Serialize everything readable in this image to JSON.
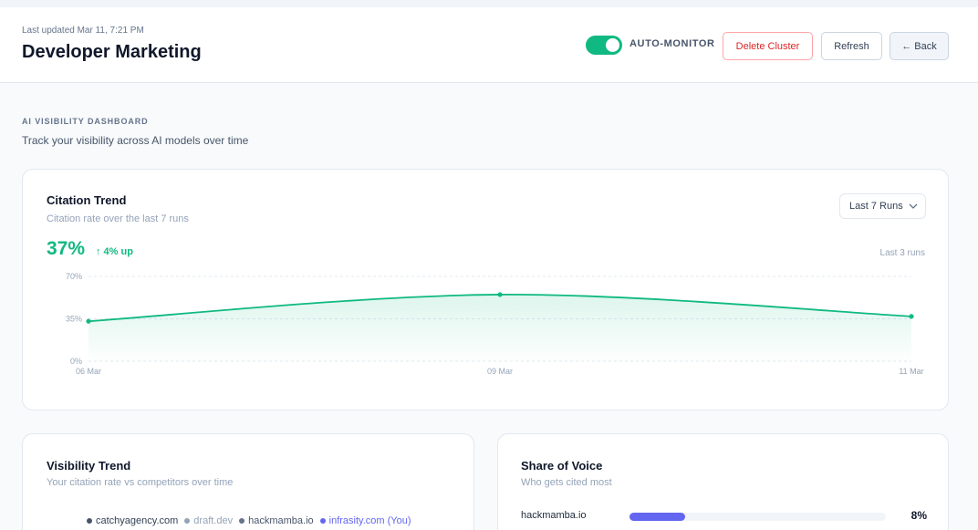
{
  "header": {
    "last_updated": "Last updated Mar 11, 7:21 PM",
    "title": "Developer Marketing",
    "auto_monitor_label": "AUTO-MONITOR",
    "auto_monitor_on": true,
    "delete_label": "Delete Cluster",
    "refresh_label": "Refresh",
    "back_label": "← Back"
  },
  "section": {
    "label": "AI VISIBILITY DASHBOARD",
    "subtitle": "Track your visibility across AI models over time"
  },
  "citation": {
    "title": "Citation Trend",
    "subtitle": "Citation rate over the last 7 runs",
    "select_value": "Last 7 Runs",
    "value": "37%",
    "delta": "↑ 4% up",
    "runs_note": "Last 3 runs"
  },
  "chart_data": {
    "type": "area",
    "x": [
      "06 Mar",
      "09 Mar",
      "11 Mar"
    ],
    "values": [
      33,
      55,
      37
    ],
    "ylim": [
      0,
      70
    ],
    "yticks": [
      "0%",
      "35%",
      "70%"
    ],
    "grid": true,
    "color": "#10b981"
  },
  "visibility": {
    "title": "Visibility Trend",
    "subtitle": "Your citation rate vs competitors over time",
    "legend": [
      {
        "label": "catchyagency.com",
        "color": "#475569",
        "text_color": "#334155"
      },
      {
        "label": "draft.dev",
        "color": "#94a3b8",
        "text_color": "#94a3b8"
      },
      {
        "label": "hackmamba.io",
        "color": "#64748b",
        "text_color": "#475569"
      },
      {
        "label": "infrasity.com (You)",
        "color": "#6366f1",
        "text_color": "#6366f1"
      }
    ]
  },
  "sov": {
    "title": "Share of Voice",
    "subtitle": "Who gets cited most",
    "rows": [
      {
        "domain": "hackmamba.io",
        "pct": "8%",
        "fraction": 0.08
      }
    ]
  }
}
